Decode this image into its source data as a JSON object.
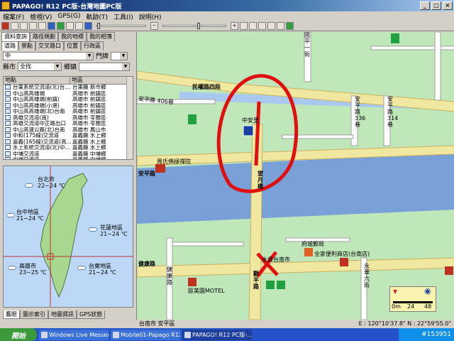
{
  "window": {
    "title": "PAPAGO! R12 PC版-台灣地圖PC版"
  },
  "menu": {
    "items": [
      "檔案(F)",
      "檢視(V)",
      "GPS(G)",
      "軌跡(T)",
      "工具(I)",
      "說明(H)"
    ]
  },
  "left": {
    "top_tabs": [
      "資料查詢",
      "路徑規劃",
      "我的地標",
      "我的相簿"
    ],
    "sub_tabs": [
      "道路",
      "景點",
      "交叉路口",
      "位置",
      "行政區"
    ],
    "type_value": "中",
    "door_label": "門牌",
    "city_label": "縣市",
    "city_value": "全找",
    "town_label": "鄉鎮",
    "grid_headers": [
      "地點",
      "地區"
    ],
    "rows": [
      [
        "台東系統交流道(北)台...",
        "台東縣 新市鄉"
      ],
      [
        "中山高高雄端",
        "高雄市 前鎮區"
      ],
      [
        "中山高高雄端(前鎮)",
        "高雄市 前鎮區"
      ],
      [
        "中山高高雄端(小港)",
        "高雄市 前鎮區"
      ],
      [
        "中山高高雄端(北)台南",
        "高雄市 前鎮區"
      ],
      [
        "高雄交流道(南)",
        "高雄市 苓雅區"
      ],
      [
        "高雄交流道中正路出口",
        "高雄市 苓雅區"
      ],
      [
        "中山高速公路(北)台南",
        "高雄市 鳳山市"
      ],
      [
        "中和(175線)交流道",
        "嘉義縣 水上鄉"
      ],
      [
        "嘉義(165線)交流道(高...",
        "嘉義縣 水上鄉"
      ],
      [
        "水上系統交流道(北)中...",
        "嘉義縣 水上鄉"
      ],
      [
        "中埔交流道",
        "嘉義縣 中埔鄉"
      ],
      [
        "中埔交流道",
        "嘉義縣 中埔鄉"
      ]
    ],
    "weather": [
      {
        "name": "台北市",
        "temp": "22~24 ℃"
      },
      {
        "name": "台中地區",
        "temp": "21~24 ℃"
      },
      {
        "name": "花蓮地區",
        "temp": "21~24 ℃"
      },
      {
        "name": "高雄市",
        "temp": "23~25 ℃"
      },
      {
        "name": "台東地區",
        "temp": "21~24 ℃"
      }
    ],
    "bottom_tabs": [
      "鷹眼",
      "圖示索引",
      "地圖資訊",
      "GPS狀態"
    ]
  },
  "map": {
    "roads": {
      "minquan": "民權路四段",
      "anping1": "安平路 406巷",
      "anping2": "安平路",
      "anping3": "安平路",
      "lane336": "安平路336巷",
      "lane314": "安平路314巷",
      "xiyue": "望月橋",
      "jiankang1": "健康路",
      "jiankang2": "健康路",
      "guoping": "國平一街",
      "bridge_s": "觀平路",
      "yongtai": "永華六街"
    },
    "places": {
      "park": "中安里",
      "temple": "周氏佛緣禪院",
      "postal": "府城郵局",
      "mart": "全家便利商店(台南店)",
      "water": "水資台南市",
      "motel": "歐美園MOTEL"
    },
    "scale": {
      "zero": "0m",
      "a": "24",
      "b": "48"
    },
    "route_color": "#e8d870",
    "annotation_color": "#e01010"
  },
  "status": {
    "location": "台南市 安平區",
    "coords": "E : 120°10'37.8\"  N : 22°59'55.0\""
  },
  "taskbar": {
    "start": "開始",
    "tasks": [
      "Windows Live Messen...",
      "Mobile01-Papago R12...",
      "PAPAGO! R12 PC版-..."
    ],
    "tray": "#153951"
  }
}
